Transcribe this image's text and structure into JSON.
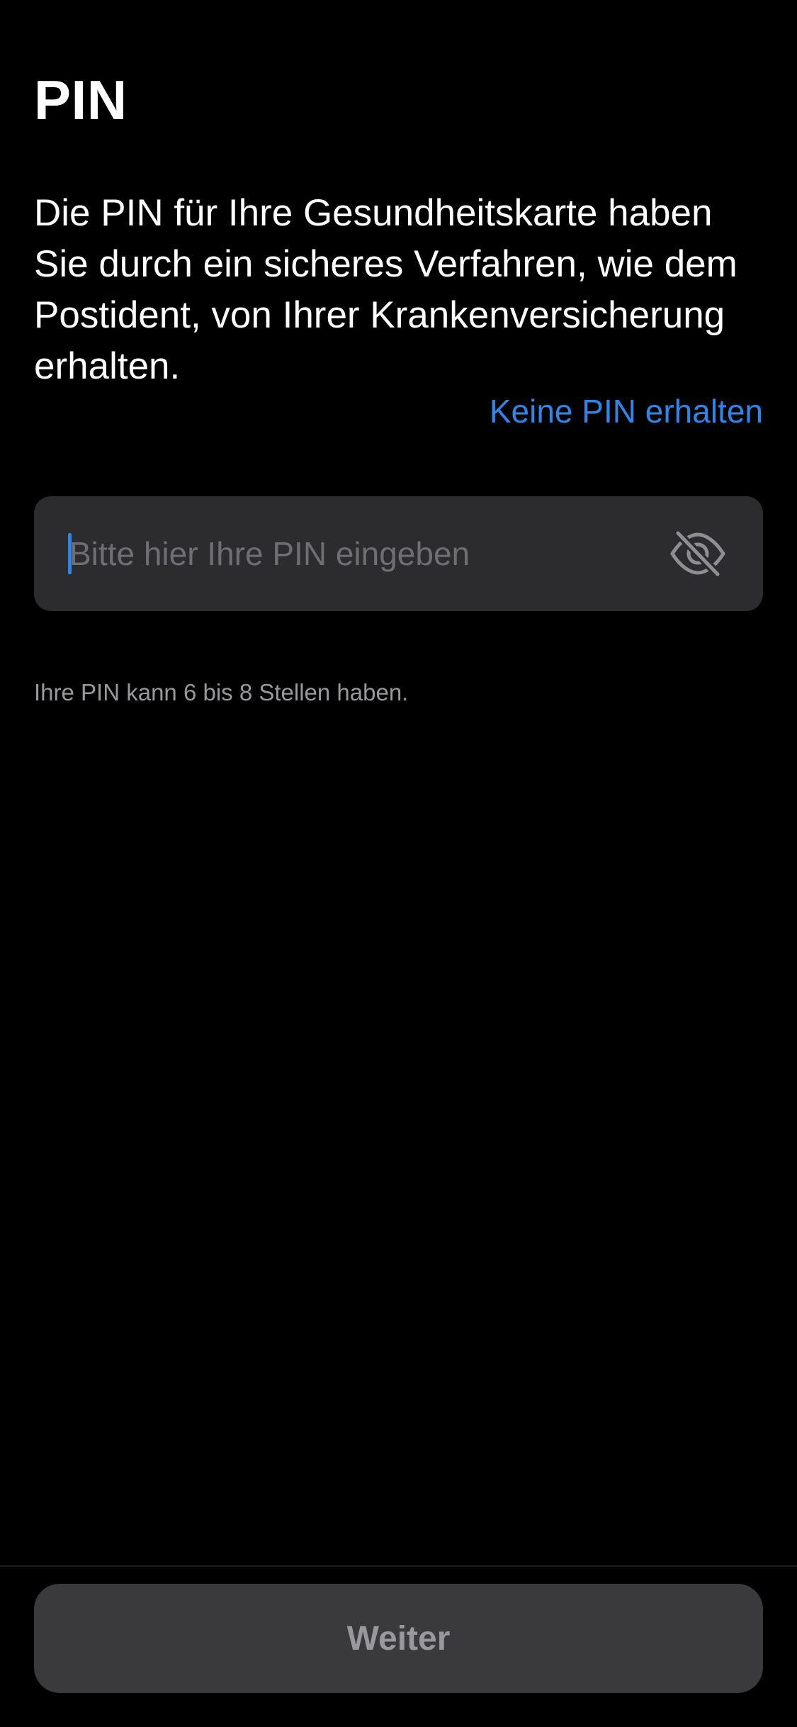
{
  "header": {
    "title": "PIN"
  },
  "content": {
    "description": "Die PIN für Ihre Gesundheitskarte haben Sie durch ein sicheres Verfahren, wie dem Postident, von Ihrer Kranken­versicherung erhalten.",
    "no_pin_link": "Keine PIN erhalten",
    "pin_field": {
      "value": "",
      "placeholder": "Bitte hier Ihre PIN eingeben",
      "toggle_icon": "eye-slash-icon"
    },
    "hint": "Ihre PIN kann 6 bis 8 Stellen haben."
  },
  "footer": {
    "continue_label": "Weiter"
  },
  "colors": {
    "background": "#000000",
    "accent": "#2f86ea",
    "field_background": "#2c2c2e",
    "button_background": "#3a3a3c",
    "secondary_text": "#98989d"
  }
}
